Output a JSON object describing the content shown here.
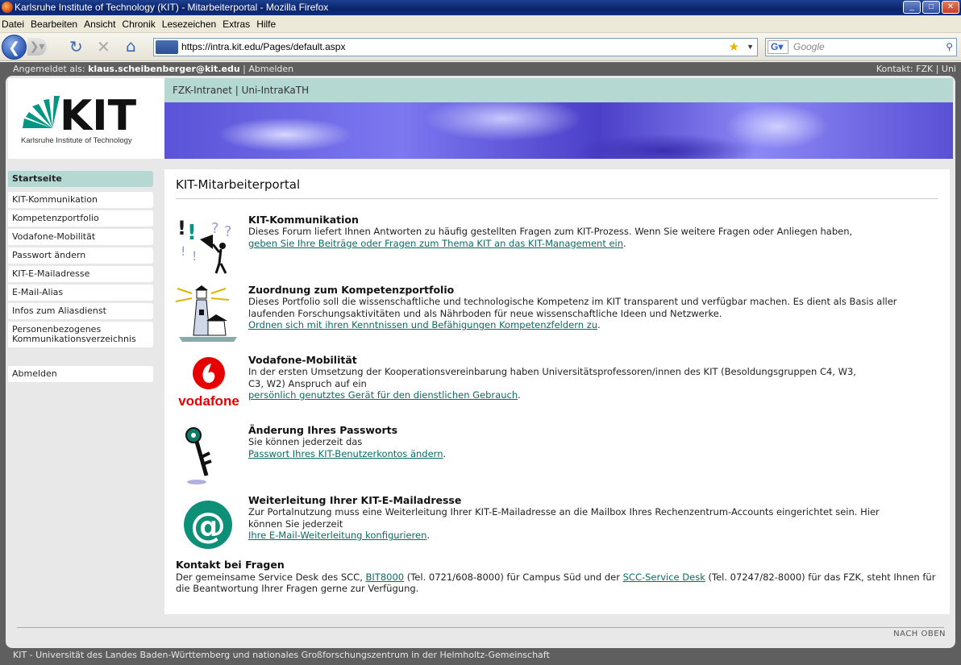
{
  "window": {
    "title": "Karlsruhe Institute of Technology (KIT) - Mitarbeiterportal - Mozilla Firefox"
  },
  "menu": [
    "Datei",
    "Bearbeiten",
    "Ansicht",
    "Chronik",
    "Lesezeichen",
    "Extras",
    "Hilfe"
  ],
  "browser": {
    "url": "https://intra.kit.edu/Pages/default.aspx",
    "search_placeholder": "Google"
  },
  "topbar": {
    "logged_in_label": "Angemeldet als:",
    "user": "klaus.scheibenberger@kit.edu",
    "logout": "| Abmelden",
    "contact": "Kontakt: FZK | Uni"
  },
  "logo": {
    "name": "KIT",
    "subtitle": "Karlsruhe Institute of Technology"
  },
  "header": {
    "tabs": "FZK-Intranet | Uni-IntraKaTH"
  },
  "sidebar": {
    "items": [
      "Startseite",
      "KIT-Kommunikation",
      "Kompetenzportfolio",
      "Vodafone-Mobilität",
      "Passwort ändern",
      "KIT-E-Mailadresse",
      "E-Mail-Alias",
      "Infos zum Aliasdienst",
      "Personenbezogenes Kommunikationsverzeichnis"
    ],
    "logout": "Abmelden"
  },
  "main": {
    "title": "KIT-Mitarbeiterportal",
    "entries": [
      {
        "title": "KIT-Kommunikation",
        "text": "Dieses Forum liefert Ihnen Antworten zu häufig gestellten Fragen zum KIT-Prozess. Wenn Sie weitere Fragen oder Anliegen haben,",
        "link": "geben Sie Ihre Beiträge oder Fragen zum Thema KIT an das KIT-Management ein",
        "tail": "."
      },
      {
        "title": "Zuordnung zum Kompetenzportfolio",
        "text": "Dieses Portfolio soll die wissenschaftliche und technologische Kompetenz im KIT transparent und verfügbar machen. Es dient als Basis aller laufenden Forschungsaktivitäten und als Nährboden für neue wissenschaftliche Ideen und Netzwerke.",
        "link": "Ordnen sich mit ihren Kenntnissen und Befähigungen Kompetenzfeldern zu",
        "tail": "."
      },
      {
        "title": "Vodafone-Mobilität",
        "text": "In der ersten Umsetzung der Kooperationsvereinbarung haben Universitätsprofessoren/innen des KIT (Besoldungsgruppen C4, W3, C3, W2) Anspruch auf ein",
        "link": "persönlich genutztes Gerät für den dienstlichen Gebrauch",
        "tail": "."
      },
      {
        "title": "Änderung Ihres Passworts",
        "text": "Sie können jederzeit das",
        "link": "Passwort Ihres KIT-Benutzerkontos ändern",
        "tail": "."
      },
      {
        "title": "Weiterleitung Ihrer KIT-E-Mailadresse",
        "text": "Zur Portalnutzung muss eine Weiterleitung Ihrer KIT-E-Mailadresse an die Mailbox Ihres Rechenzentrum-Accounts eingerichtet sein. Hier können Sie jederzeit",
        "link": "Ihre E-Mail-Weiterleitung konfigurieren",
        "tail": "."
      }
    ],
    "vodafone_logo": "vodafone",
    "contact": {
      "title": "Kontakt bei Fragen",
      "text1": "Der gemeinsame Service Desk des SCC,",
      "link1": "BIT8000",
      "text2": "(Tel. 0721/608-8000) für Campus Süd und der",
      "link2": "SCC-Service Desk",
      "text3": "(Tel. 07247/82-8000) für das FZK, steht Ihnen für die Beantwortung Ihrer Fragen gerne zur Verfügung."
    }
  },
  "footer": {
    "nach_oben": "NACH OBEN",
    "bottom": "KIT - Universität des Landes Baden-Württemberg und nationales Großforschungszentrum in der Helmholtz-Gemeinschaft"
  },
  "colors": {
    "accent": "#b5d8d3",
    "link": "#0c6b63",
    "kit_green": "#009682",
    "page_bg": "#5f5f5f"
  }
}
